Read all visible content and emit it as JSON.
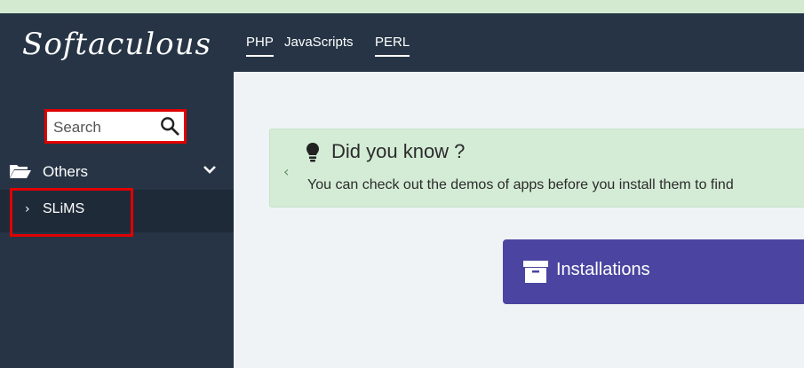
{
  "sidebar": {
    "logo_text": "Softaculous",
    "search": {
      "placeholder": "Search"
    },
    "category": {
      "label": "Others"
    },
    "items": [
      {
        "label": "SLiMS"
      }
    ]
  },
  "topnav": {
    "tabs": [
      {
        "label": "PHP"
      },
      {
        "label": "JavaScripts"
      },
      {
        "label": "PERL"
      }
    ]
  },
  "did_you_know": {
    "title": "Did you know ?",
    "text": "You can check out the demos of apps before you install them to find"
  },
  "installations": {
    "label": "Installations"
  },
  "colors": {
    "sidebar_bg": "#263445",
    "highlight_border": "#e00000",
    "notice_bg": "#d4ecd6",
    "installations_bg": "#4b45a1"
  }
}
